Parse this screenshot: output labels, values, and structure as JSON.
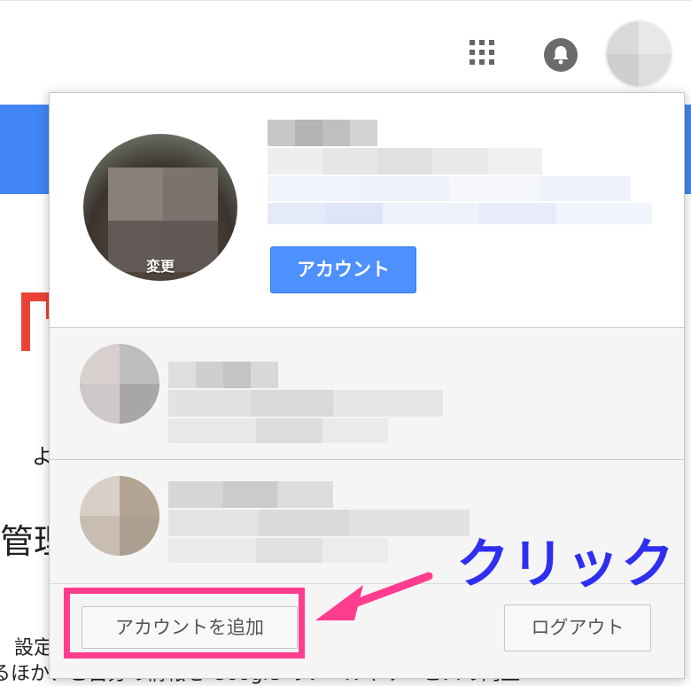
{
  "header": {
    "apps_icon": "apps-grid-icon",
    "notification_icon": "bell-icon",
    "avatar": "account-avatar"
  },
  "background": {
    "text_yo": "よ",
    "text_kanri": "管理",
    "text_settei": "設定",
    "text_bottom": "るほか、ご自分の情報を Google のツールやサービスの向上"
  },
  "popup": {
    "change_photo_label": "変更",
    "account_button": "アカウント",
    "add_account_button": "アカウントを追加",
    "logout_button": "ログアウト"
  },
  "annotation": {
    "click_label": "クリック",
    "highlight_color": "#ff3d8e",
    "label_color": "#2f2ff0"
  },
  "colors": {
    "accent_blue": "#4285f4",
    "button_blue": "#4d90fe"
  }
}
